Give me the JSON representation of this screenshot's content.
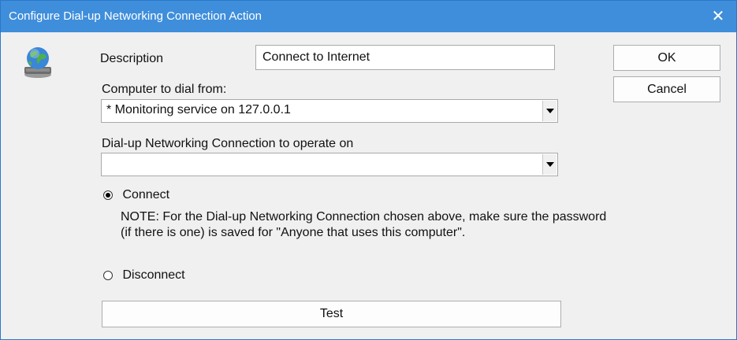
{
  "window": {
    "title": "Configure Dial-up Networking Connection Action",
    "close_glyph": "✕",
    "icon": "globe-network-icon"
  },
  "form": {
    "description_label": "Description",
    "description_value": "Connect to Internet",
    "computer_label": "Computer to dial from:",
    "computer_value": "* Monitoring service on  127.0.0.1",
    "dun_label": "Dial-up Networking Connection to operate on",
    "dun_value": "",
    "connect_label": "Connect",
    "connect_selected": true,
    "note": "NOTE: For the Dial-up Networking Connection chosen above, make sure the password (if there is one) is saved for \"Anyone that uses this computer\".",
    "disconnect_label": "Disconnect",
    "disconnect_selected": false
  },
  "buttons": {
    "ok": "OK",
    "cancel": "Cancel",
    "test": "Test"
  }
}
